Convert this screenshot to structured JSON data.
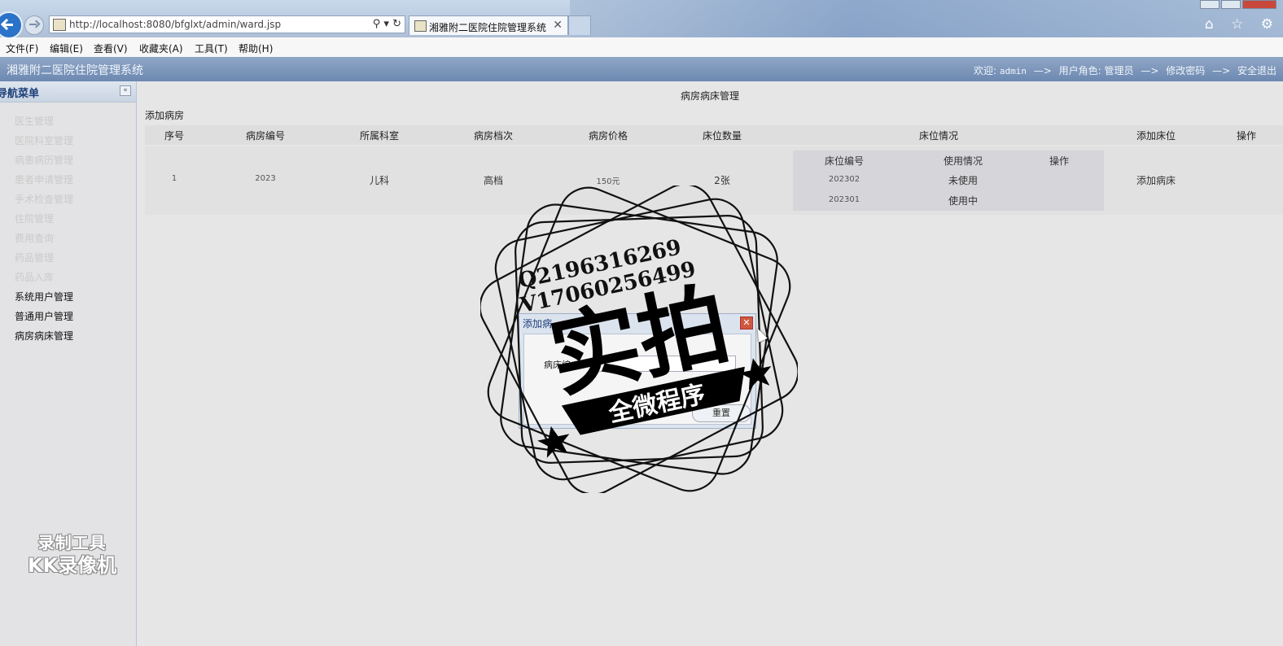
{
  "browser": {
    "url": "http://localhost:8080/bfglxt/admin/ward.jsp",
    "tab_title": "湘雅附二医院住院管理系统",
    "tab_close": "✕",
    "search_glyph": "⚲ ▾ ↻",
    "right_icons": "⌂ ☆ ⚙"
  },
  "menubar": [
    "文件(F)",
    "编辑(E)",
    "查看(V)",
    "收藏夹(A)",
    "工具(T)",
    "帮助(H)"
  ],
  "header": {
    "app_title": "湘雅附二医院住院管理系统",
    "welcome": "欢迎:",
    "username": "admin",
    "arrow": "—>",
    "role": "用户角色: 管理员",
    "change_password": "修改密码",
    "logout": "安全退出"
  },
  "sidebar": {
    "title": "导航菜单",
    "collapse_glyph": "«",
    "items": [
      {
        "label": "医生管理",
        "active": false
      },
      {
        "label": "医院科室管理",
        "active": false
      },
      {
        "label": "病患病历管理",
        "active": false
      },
      {
        "label": "患者申请管理",
        "active": false
      },
      {
        "label": "手术检查管理",
        "active": false
      },
      {
        "label": "住院管理",
        "active": false
      },
      {
        "label": "费用查询",
        "active": false
      },
      {
        "label": "药品管理",
        "active": false
      },
      {
        "label": "药品入库",
        "active": false
      },
      {
        "label": "系统用户管理",
        "active": true
      },
      {
        "label": "普通用户管理",
        "active": true
      },
      {
        "label": "病房病床管理",
        "active": true
      }
    ]
  },
  "main": {
    "page_title": "病房病床管理",
    "add_ward": "添加病房",
    "columns": [
      "序号",
      "病房编号",
      "所属科室",
      "病房档次",
      "病房价格",
      "床位数量",
      "床位情况",
      "添加床位",
      "操作"
    ],
    "rows": [
      {
        "index": "1",
        "ward_no": "2023",
        "department": "儿科",
        "level": "高档",
        "price": "150元",
        "bed_count": "2张",
        "add_bed": "添加病床",
        "bed_columns": [
          "床位编号",
          "使用情况",
          "操作"
        ],
        "beds": [
          {
            "bed_no": "202302",
            "status": "未使用"
          },
          {
            "bed_no": "202301",
            "status": "使用中"
          }
        ]
      }
    ]
  },
  "dialog": {
    "title": "添加病",
    "close_glyph": "✕",
    "field_label": "病床编",
    "reset_button": "重置"
  },
  "watermark": {
    "qq": "Q2196316269",
    "wechat": "V17060256499",
    "big_text": "实拍",
    "banner": "全微程序"
  },
  "recorder_watermark": {
    "line1": "录制工具",
    "line2": "KK录像机"
  }
}
